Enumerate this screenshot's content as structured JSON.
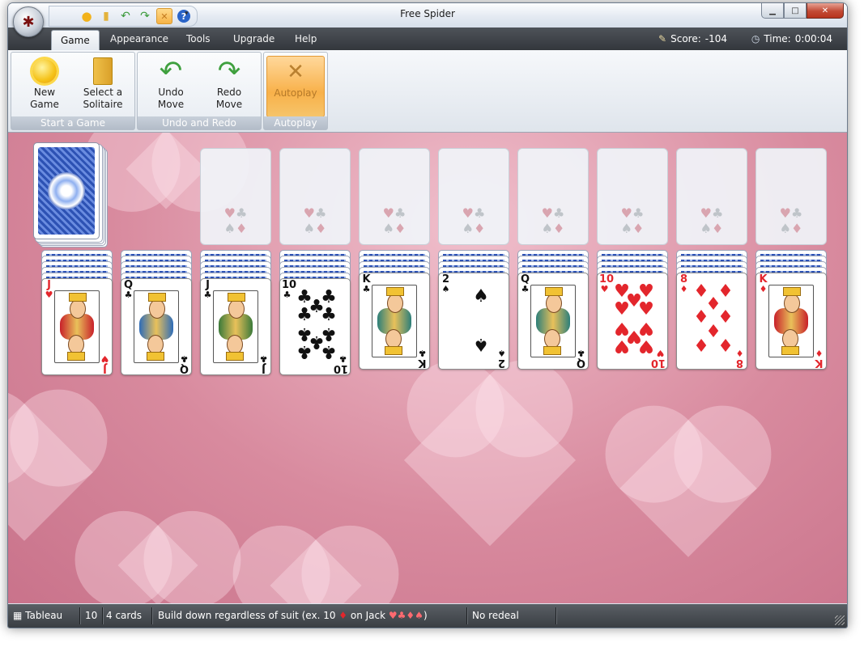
{
  "window": {
    "title": "Free Spider"
  },
  "qat_icons": [
    "new-game-icon",
    "select-solitaire-icon",
    "undo-icon",
    "redo-icon",
    "autoplay-icon",
    "help-icon"
  ],
  "menu": {
    "tabs": [
      {
        "label": "Game"
      },
      {
        "label": "Appearance"
      },
      {
        "label": "Tools"
      },
      {
        "label": "Upgrade"
      },
      {
        "label": "Help"
      }
    ],
    "score_label": "Score:",
    "score_value": "-104",
    "time_label": "Time:",
    "time_value": "0:00:04"
  },
  "ribbon": {
    "groups": [
      {
        "label": "Start a Game",
        "buttons": [
          {
            "line1": "New",
            "line2": "Game"
          },
          {
            "line1": "Select a",
            "line2": "Solitaire"
          }
        ]
      },
      {
        "label": "Undo and Redo",
        "buttons": [
          {
            "line1": "Undo",
            "line2": "Move"
          },
          {
            "line1": "Redo",
            "line2": "Move"
          }
        ]
      },
      {
        "label": "Autoplay",
        "buttons": [
          {
            "line1": "Autoplay",
            "line2": ""
          }
        ]
      }
    ]
  },
  "tableau": {
    "foundation_suits": [
      "♥",
      "♣",
      "♠",
      "♦"
    ],
    "columns": [
      {
        "rank": "J",
        "suit": "♥",
        "color": "red",
        "face": "court",
        "robe": "#c8202a"
      },
      {
        "rank": "Q",
        "suit": "♣",
        "color": "blk",
        "face": "court",
        "robe": "#2e6cb8"
      },
      {
        "rank": "J",
        "suit": "♣",
        "color": "blk",
        "face": "court",
        "robe": "#3b7a3a"
      },
      {
        "rank": "10",
        "suit": "♣",
        "color": "blk",
        "face": "pips"
      },
      {
        "rank": "K",
        "suit": "♣",
        "color": "blk",
        "face": "court",
        "robe": "#2c7f7a"
      },
      {
        "rank": "2",
        "suit": "♠",
        "color": "blk",
        "face": "pips"
      },
      {
        "rank": "Q",
        "suit": "♣",
        "color": "blk",
        "face": "court",
        "robe": "#2c7f7a"
      },
      {
        "rank": "10",
        "suit": "♥",
        "color": "red",
        "face": "pips"
      },
      {
        "rank": "8",
        "suit": "♦",
        "color": "red",
        "face": "pips"
      },
      {
        "rank": "K",
        "suit": "♦",
        "color": "red",
        "face": "court",
        "robe": "#c8202a"
      }
    ]
  },
  "status": {
    "pile_type": "Tableau",
    "count": "10",
    "cards": "4 cards",
    "rule_prefix": "Build down regardless of suit (ex. 10 ",
    "rule_suit1": "♦",
    "rule_mid": " on Jack ",
    "rule_suits": "♥♣♦♠",
    "rule_suffix": ")",
    "redeal": "No redeal"
  }
}
